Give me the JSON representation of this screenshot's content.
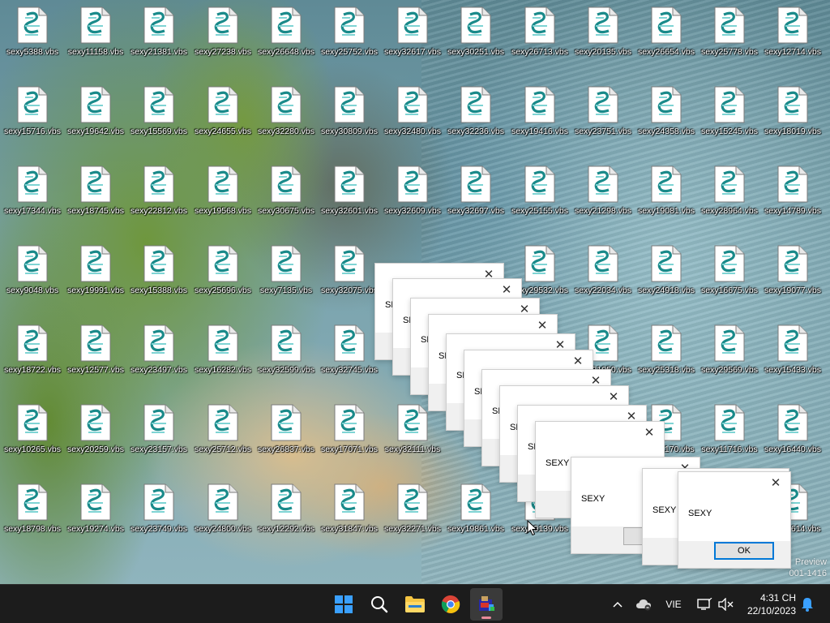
{
  "desktop": {
    "icon_rows": [
      [
        "sexy5388.vbs",
        "sexy11158.vbs",
        "sexy21381.vbs",
        "sexy27238.vbs",
        "sexy26648.vbs",
        "sexy25752.vbs",
        "sexy32617.vbs",
        "sexy30251.vbs",
        "sexy26713.vbs",
        "sexy20135.vbs",
        "sexy26654.vbs",
        "sexy25778.vbs",
        "sexy12714.vbs"
      ],
      [
        "sexy15716.vbs",
        "sexy19642.vbs",
        "sexy15569.vbs",
        "sexy24655.vbs",
        "sexy32280.vbs",
        "sexy30809.vbs",
        "sexy32480.vbs",
        "sexy32236.vbs",
        "sexy19416.vbs",
        "sexy23751.vbs",
        "sexy24358.vbs",
        "sexy15245.vbs",
        "sexy18019.vbs"
      ],
      [
        "sexy17344.vbs",
        "sexy18745.vbs",
        "sexy22812.vbs",
        "sexy19568.vbs",
        "sexy30675.vbs",
        "sexy32601.vbs",
        "sexy32609.vbs",
        "sexy32697.vbs",
        "sexy25155.vbs",
        "sexy21298.vbs",
        "sexy19081.vbs",
        "sexy28964.vbs",
        "sexy14789.vbs"
      ],
      [
        "sexy9048.vbs",
        "sexy19991.vbs",
        "sexy15388.vbs",
        "sexy25696.vbs",
        "sexy7135.vbs",
        "sexy32075.vbs",
        "",
        "",
        "sexy29532.vbs",
        "sexy22034.vbs",
        "sexy24918.vbs",
        "sexy16675.vbs",
        "sexy19077.vbs"
      ],
      [
        "sexy18722.vbs",
        "sexy12577.vbs",
        "sexy23497.vbs",
        "sexy16282.vbs",
        "sexy32599.vbs",
        "sexy32745.vbs",
        "",
        "",
        "",
        "sexy31050.vbs",
        "sexy25318.vbs",
        "sexy29569.vbs",
        "sexy15433.vbs"
      ],
      [
        "sexy10265.vbs",
        "sexy20259.vbs",
        "sexy23157.vbs",
        "sexy25712.vbs",
        "sexy26837.vbs",
        "sexy17071.vbs",
        "sexy32111.vbs",
        "",
        "",
        "",
        "sexy31170.vbs",
        "sexy11716.vbs",
        "sexy16440.vbs"
      ],
      [
        "sexy18798.vbs",
        "sexy19274.vbs",
        "sexy23749.vbs",
        "sexy24800.vbs",
        "sexy12292.vbs",
        "sexy31847.vbs",
        "sexy32271.vbs",
        "sexy19861.vbs",
        "sexy29139.vbs",
        "",
        "",
        "",
        "sexy11614.vbs"
      ]
    ]
  },
  "message_boxes": [
    {
      "message": "SEXY",
      "ok_label": "OK"
    },
    {
      "message": "SEXY",
      "ok_label": "OK"
    },
    {
      "message": "SEXY",
      "ok_label": "OK"
    },
    {
      "message": "SEXY",
      "ok_label": "OK"
    },
    {
      "message": "SEXY",
      "ok_label": "OK"
    },
    {
      "message": "SEXY",
      "ok_label": "OK"
    },
    {
      "message": "SEXY",
      "ok_label": "OK"
    },
    {
      "message": "SEXY",
      "ok_label": "OK"
    },
    {
      "message": "SEXY",
      "ok_label": "OK"
    },
    {
      "message": "SEXY",
      "ok_label": "OK"
    },
    {
      "message": "SEXY",
      "ok_label": "OK"
    },
    {
      "message": "SEXY",
      "ok_label": "OK"
    },
    {
      "message": "SEXY",
      "ok_label": "OK"
    }
  ],
  "watermark": {
    "line1": "Preview",
    "line2": "001-1416"
  },
  "taskbar": {
    "apps": [
      {
        "name": "start-icon"
      },
      {
        "name": "search-icon"
      },
      {
        "name": "file-explorer-icon"
      },
      {
        "name": "chrome-icon"
      },
      {
        "name": "script-app-icon",
        "active": true
      }
    ],
    "tray": {
      "language": "VIE",
      "time": "4:31 CH",
      "date": "22/10/2023"
    }
  }
}
